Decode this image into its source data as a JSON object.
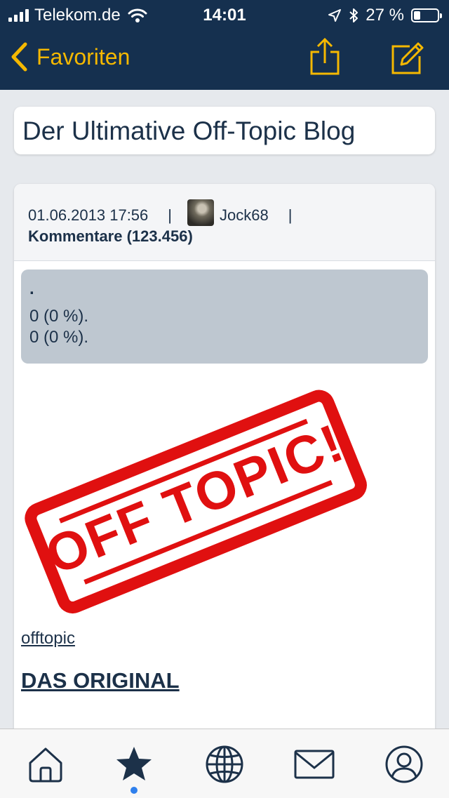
{
  "status_bar": {
    "carrier": "Telekom.de",
    "time": "14:01",
    "battery": "27 %",
    "battery_level": 0.27,
    "icons": [
      "signal-icon",
      "wifi-icon",
      "location-icon",
      "bluetooth-icon",
      "battery-icon"
    ]
  },
  "navbar": {
    "back_label": "Favoriten",
    "actions": [
      "share-icon",
      "compose-icon"
    ],
    "accent_color": "#f5b800",
    "background_color": "#15304f"
  },
  "blog": {
    "title": "Der Ultimative Off-Topic Blog"
  },
  "post": {
    "date": "01.06.2013 17:56",
    "separator": "|",
    "author": "Jock68",
    "comments": "Kommentare (123.456)",
    "poll": {
      "question": ".",
      "results": [
        "0 (0 %).",
        "0 (0 %)."
      ]
    },
    "stamp": {
      "text": "OFF TOPIC!",
      "color": "#e01010"
    },
    "tag": "offtopic",
    "headline": "DAS ORIGINAL"
  },
  "tabbar": {
    "tabs": [
      "home-icon",
      "favorites-star-icon",
      "globe-icon",
      "mail-icon",
      "profile-icon"
    ],
    "active_index": 1,
    "indicator_color": "#2f80ed"
  }
}
